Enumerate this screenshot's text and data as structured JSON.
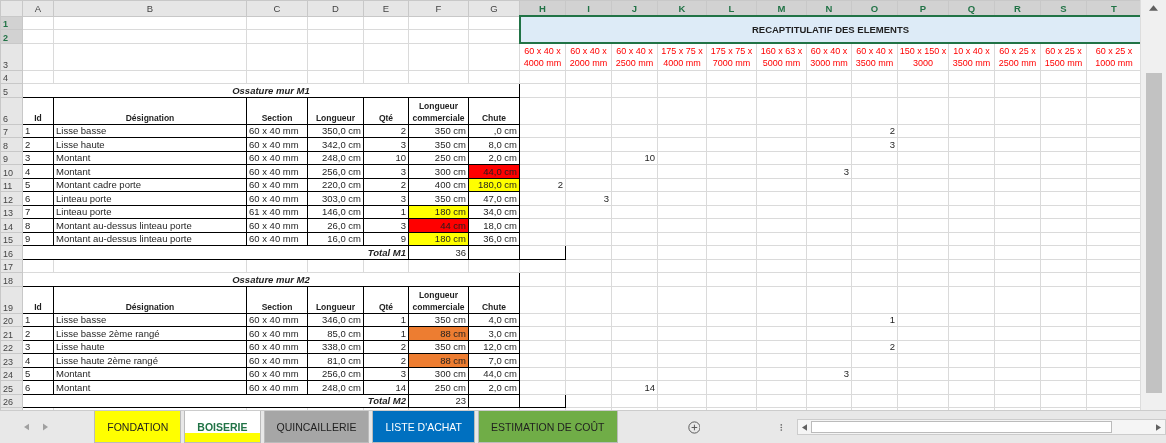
{
  "sheet": {
    "columns": [
      {
        "label": "A",
        "selected": false
      },
      {
        "label": "B",
        "selected": false
      },
      {
        "label": "C",
        "selected": false
      },
      {
        "label": "D",
        "selected": false
      },
      {
        "label": "E",
        "selected": false
      },
      {
        "label": "F",
        "selected": false
      },
      {
        "label": "G",
        "selected": false
      },
      {
        "label": "H",
        "selected": true
      },
      {
        "label": "I",
        "selected": true
      },
      {
        "label": "J",
        "selected": true
      },
      {
        "label": "K",
        "selected": true
      },
      {
        "label": "L",
        "selected": true
      },
      {
        "label": "M",
        "selected": true
      },
      {
        "label": "N",
        "selected": true
      },
      {
        "label": "O",
        "selected": true
      },
      {
        "label": "P",
        "selected": true
      },
      {
        "label": "Q",
        "selected": true
      },
      {
        "label": "R",
        "selected": true
      },
      {
        "label": "S",
        "selected": true
      },
      {
        "label": "T",
        "selected": true
      }
    ],
    "rows": [
      {
        "label": "1",
        "selected": true
      },
      {
        "label": "2",
        "selected": true
      },
      {
        "label": "3",
        "selected": false
      },
      {
        "label": "4",
        "selected": false
      },
      {
        "label": "5",
        "selected": false
      },
      {
        "label": "6",
        "selected": false
      },
      {
        "label": "7",
        "selected": false
      },
      {
        "label": "8",
        "selected": false
      },
      {
        "label": "9",
        "selected": false
      },
      {
        "label": "10",
        "selected": false
      },
      {
        "label": "11",
        "selected": false
      },
      {
        "label": "12",
        "selected": false
      },
      {
        "label": "13",
        "selected": false
      },
      {
        "label": "14",
        "selected": false
      },
      {
        "label": "15",
        "selected": false
      },
      {
        "label": "16",
        "selected": false
      },
      {
        "label": "17",
        "selected": false
      },
      {
        "label": "18",
        "selected": false
      },
      {
        "label": "19",
        "selected": false
      },
      {
        "label": "20",
        "selected": false
      },
      {
        "label": "21",
        "selected": false
      },
      {
        "label": "22",
        "selected": false
      },
      {
        "label": "23",
        "selected": false
      },
      {
        "label": "24",
        "selected": false
      },
      {
        "label": "25",
        "selected": false
      },
      {
        "label": "26",
        "selected": false
      }
    ]
  },
  "recap": {
    "title": "RECAPTITULATIF DES ELEMENTS",
    "columns": [
      "60 x 40 x 4000 mm",
      "60 x 40 x 2000 mm",
      "60 x 40 x 2500 mm",
      "175 x 75 x 4000 mm",
      "175 x 75 x 7000 mm",
      "160 x 63 x 5000 mm",
      "60 x 40 x 3000 mm",
      "60 x 40 x 3500 mm",
      "150 x 150 x 3000",
      "10 x 40 x 3500 mm",
      "60 x 25 x 2500 mm",
      "60 x 25 x 1500 mm",
      "60 x 25 x 1000 mm"
    ]
  },
  "tables": [
    {
      "title": "Ossature mur M1",
      "columns": [
        "Id",
        "Désignation",
        "Section",
        "Longueur",
        "Qté",
        "Longueur commerciale",
        "Chute"
      ],
      "rows": [
        {
          "cells": [
            "1",
            "Lisse basse",
            "60 x 40 mm",
            "350,0 cm",
            "2"
          ],
          "commerciale": {
            "text": "350 cm"
          },
          "chute": {
            "text": ",0 cm"
          },
          "recap": {
            "7": "2"
          }
        },
        {
          "cells": [
            "2",
            "Lisse haute",
            "60 x 40 mm",
            "342,0 cm",
            "3"
          ],
          "commerciale": {
            "text": "350 cm"
          },
          "chute": {
            "text": "8,0 cm"
          },
          "recap": {
            "7": "3"
          }
        },
        {
          "cells": [
            "3",
            "Montant",
            "60 x 40 mm",
            "248,0 cm",
            "10"
          ],
          "commerciale": {
            "text": "250 cm"
          },
          "chute": {
            "text": "2,0 cm"
          },
          "recap": {
            "2": "10"
          }
        },
        {
          "cells": [
            "4",
            "Montant",
            "60 x 40 mm",
            "256,0 cm",
            "3"
          ],
          "commerciale": {
            "text": "300 cm"
          },
          "chute": {
            "text": "44,0 cm",
            "color": "#ff0000"
          },
          "recap": {
            "6": "3"
          }
        },
        {
          "cells": [
            "5",
            "Montant cadre porte",
            "60 x 40 mm",
            "220,0 cm",
            "2"
          ],
          "commerciale": {
            "text": "400 cm"
          },
          "chute": {
            "text": "180,0 cm",
            "color": "#ffff00"
          },
          "recap": {
            "0": "2"
          }
        },
        {
          "cells": [
            "6",
            "Linteau porte",
            "60 x 40 mm",
            "303,0 cm",
            "3"
          ],
          "commerciale": {
            "text": "350 cm"
          },
          "chute": {
            "text": "47,0 cm"
          },
          "recap": {
            "1": "3"
          }
        },
        {
          "cells": [
            "7",
            "Linteau porte",
            "61 x 40 mm",
            "146,0 cm",
            "1"
          ],
          "commerciale": {
            "text": "180 cm",
            "color": "#ffff00"
          },
          "chute": {
            "text": "34,0 cm"
          }
        },
        {
          "cells": [
            "8",
            "Montant au-dessus linteau porte",
            "60 x 40 mm",
            "26,0 cm",
            "3"
          ],
          "commerciale": {
            "text": "44 cm",
            "color": "#ff0000"
          },
          "chute": {
            "text": "18,0 cm"
          }
        },
        {
          "cells": [
            "9",
            "Montant au-dessus linteau porte",
            "60 x 40 mm",
            "16,0 cm",
            "9"
          ],
          "commerciale": {
            "text": "180 cm",
            "color": "#ffff00"
          },
          "chute": {
            "text": "36,0 cm"
          }
        }
      ],
      "total_label": "Total M1",
      "total": "36"
    },
    {
      "title": "Ossature mur M2",
      "columns": [
        "Id",
        "Désignation",
        "Section",
        "Longueur",
        "Qté",
        "Longueur commerciale",
        "Chute"
      ],
      "rows": [
        {
          "cells": [
            "1",
            "Lisse basse",
            "60 x 40 mm",
            "346,0 cm",
            "1"
          ],
          "commerciale": {
            "text": "350 cm"
          },
          "chute": {
            "text": "4,0 cm"
          },
          "recap": {
            "7": "1"
          }
        },
        {
          "cells": [
            "2",
            "Lisse basse 2ème rangé",
            "60 x 40 mm",
            "85,0 cm",
            "1"
          ],
          "commerciale": {
            "text": "88 cm",
            "color": "#ed7d31"
          },
          "chute": {
            "text": "3,0 cm"
          }
        },
        {
          "cells": [
            "3",
            "Lisse haute",
            "60 x 40 mm",
            "338,0 cm",
            "2"
          ],
          "commerciale": {
            "text": "350 cm"
          },
          "chute": {
            "text": "12,0 cm"
          },
          "recap": {
            "7": "2"
          }
        },
        {
          "cells": [
            "4",
            "Lisse haute 2ème rangé",
            "60 x 40 mm",
            "81,0 cm",
            "2"
          ],
          "commerciale": {
            "text": "88 cm",
            "color": "#ed7d31"
          },
          "chute": {
            "text": "7,0 cm"
          }
        },
        {
          "cells": [
            "5",
            "Montant",
            "60 x 40 mm",
            "256,0 cm",
            "3"
          ],
          "commerciale": {
            "text": "300 cm"
          },
          "chute": {
            "text": "44,0 cm"
          },
          "recap": {
            "6": "3"
          }
        },
        {
          "cells": [
            "6",
            "Montant",
            "60 x 40 mm",
            "248,0 cm",
            "14"
          ],
          "commerciale": {
            "text": "250 cm"
          },
          "chute": {
            "text": "2,0 cm"
          },
          "recap": {
            "2": "14"
          }
        }
      ],
      "total_label": "Total M2",
      "total": "23"
    }
  ],
  "tabs": [
    {
      "label": "FONDATION",
      "color": "#ffff00",
      "selected": false
    },
    {
      "label": "BOISERIE",
      "color": "#ffff00",
      "selected": true
    },
    {
      "label": "QUINCAILLERIE",
      "color": "#a6a6a6",
      "selected": false
    },
    {
      "label": "LISTE D'ACHAT",
      "color": "#0070c0",
      "selected": false
    },
    {
      "label": "ESTIMATION DE COÛT",
      "color": "#70ad47",
      "selected": false
    }
  ]
}
